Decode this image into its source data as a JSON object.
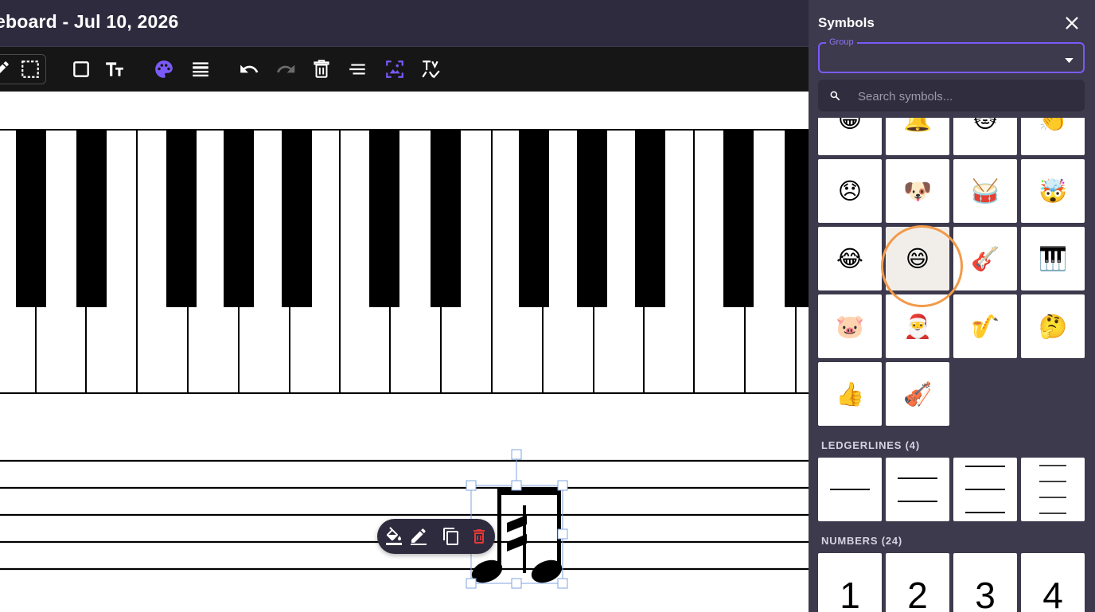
{
  "header": {
    "title": "eboard - Jul 10, 2026"
  },
  "toolbar": {
    "buttons": [
      "pencil-icon",
      "select-area-icon",
      "rectangle-icon",
      "text-size-icon",
      "palette-icon",
      "lines-icon",
      "undo-icon",
      "redo-icon",
      "delete-icon",
      "align-icon",
      "image-fit-icon",
      "spellcheck-icon"
    ]
  },
  "floating_toolbar": {
    "buttons": [
      "fill-icon",
      "edit-icon",
      "duplicate-icon",
      "delete-icon"
    ]
  },
  "panel": {
    "title": "Symbols",
    "group": {
      "label": "Group",
      "value": ""
    },
    "search": {
      "placeholder": "Search symbols..."
    },
    "emoji_rows": [
      [
        "😁",
        "🔔",
        "🐱",
        "👏"
      ],
      [
        "😞",
        "🐶",
        "🥁",
        "🤯"
      ],
      [
        "😂",
        "😄",
        "🎸",
        "🎹"
      ],
      [
        "🐷",
        "🎅",
        "🎷",
        "🤔"
      ],
      [
        "👍",
        "🎻"
      ]
    ],
    "ledgerlines_label": "LEDGERLINES (4)",
    "numbers_label": "NUMBERS (24)",
    "numbers": [
      "1",
      "2",
      "3",
      "4"
    ]
  },
  "colors": {
    "accent": "#7a5af8",
    "panel_bg": "#3d3a4d",
    "header_bg": "#2e2b3f",
    "toolbar_bg": "#161616",
    "highlight": "#f29a4a",
    "delete_red": "#e53935"
  }
}
